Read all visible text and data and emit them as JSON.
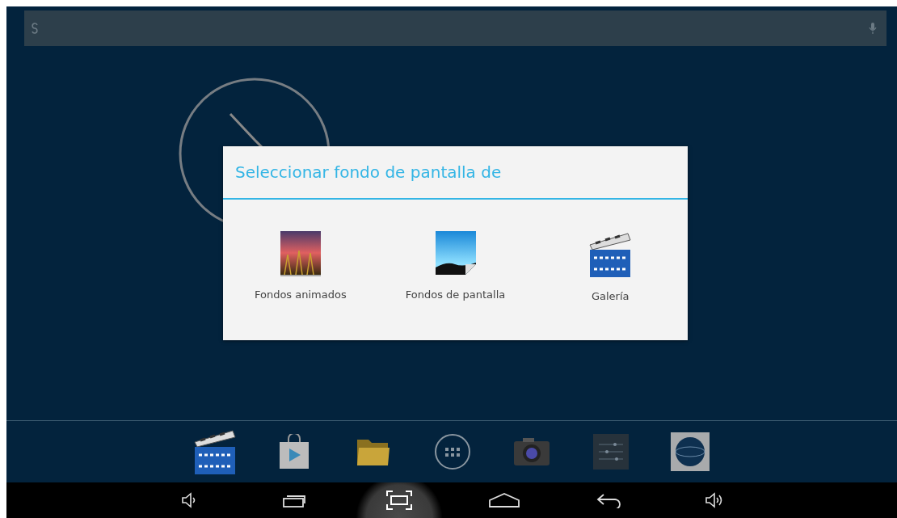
{
  "dialog": {
    "title": "Seleccionar fondo de pantalla de",
    "options": [
      {
        "label": "Fondos animados",
        "kind": "live"
      },
      {
        "label": "Fondos de pantalla",
        "kind": "wallpaper"
      },
      {
        "label": "Galería",
        "kind": "gallery"
      }
    ]
  },
  "dock": [
    {
      "kind": "gallery"
    },
    {
      "kind": "store"
    },
    {
      "kind": "folder"
    },
    {
      "kind": "apps"
    },
    {
      "kind": "camera"
    },
    {
      "kind": "settings"
    },
    {
      "kind": "internet"
    }
  ],
  "nav": [
    {
      "kind": "volume-down",
      "selected": false
    },
    {
      "kind": "recents",
      "selected": false
    },
    {
      "kind": "screenshot",
      "selected": true
    },
    {
      "kind": "home",
      "selected": false
    },
    {
      "kind": "back",
      "selected": false
    },
    {
      "kind": "volume-up",
      "selected": false
    }
  ]
}
